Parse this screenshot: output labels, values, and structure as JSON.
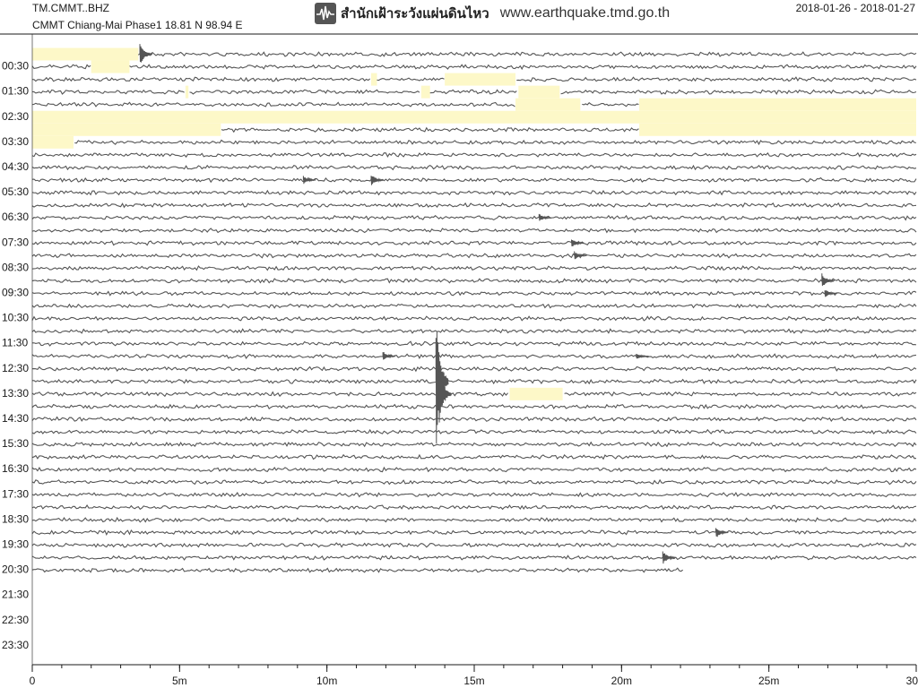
{
  "header": {
    "station_code": "TM.CMMT..BHZ",
    "station_desc": "CMMT Chiang-Mai Phase1  18.81 N 98.94 E",
    "agency_name": "สำนักเฝ้าระวังแผ่นดินไหว",
    "website": "www.earthquake.tmd.go.th",
    "date_range": "2018-01-26 - 2018-01-27",
    "logo_icon": "seismograph-icon"
  },
  "colors": {
    "trace": "#555555",
    "gap_highlight": "#fdf8c8",
    "axis": "#1a1a1a",
    "header_rule": "#1a1a1a"
  },
  "hour_labels": [
    "00:30",
    "01:30",
    "02:30",
    "03:30",
    "04:30",
    "05:30",
    "06:30",
    "07:30",
    "08:30",
    "09:30",
    "10:30",
    "11:30",
    "12:30",
    "13:30",
    "14:30",
    "15:30",
    "16:30",
    "17:30",
    "18:30",
    "19:30",
    "20:30",
    "21:30",
    "22:30",
    "23:30"
  ],
  "x_axis": {
    "labels": [
      "0",
      "5m",
      "10m",
      "15m",
      "20m",
      "25m",
      "30"
    ],
    "label_minutes": [
      0,
      5,
      10,
      15,
      20,
      25,
      30
    ],
    "minor_tick_minutes": [
      0,
      1,
      2,
      3,
      4,
      5,
      6,
      7,
      8,
      9,
      10,
      11,
      12,
      13,
      14,
      15,
      16,
      17,
      18,
      19,
      20,
      21,
      22,
      23,
      24,
      25,
      26,
      27,
      28,
      29,
      30
    ],
    "unit": "minutes",
    "range": [
      0,
      30
    ]
  },
  "traces": {
    "line_count": 42,
    "lines_per_hour": 2,
    "last_line_end_minute": 22.1,
    "gaps": [
      {
        "line": 0,
        "from_min": 0,
        "to_min": 3.6
      },
      {
        "line": 1,
        "from_min": 2.0,
        "to_min": 3.3
      },
      {
        "line": 2,
        "from_min": 11.5,
        "to_min": 11.7
      },
      {
        "line": 2,
        "from_min": 14.0,
        "to_min": 16.4
      },
      {
        "line": 3,
        "from_min": 5.2,
        "to_min": 5.3
      },
      {
        "line": 3,
        "from_min": 13.2,
        "to_min": 13.5
      },
      {
        "line": 3,
        "from_min": 16.5,
        "to_min": 17.9
      },
      {
        "line": 4,
        "from_min": 16.4,
        "to_min": 18.6
      },
      {
        "line": 4,
        "from_min": 20.6,
        "to_min": 30
      },
      {
        "line": 5,
        "from_min": 0,
        "to_min": 30
      },
      {
        "line": 6,
        "from_min": 0,
        "to_min": 6.4
      },
      {
        "line": 6,
        "from_min": 20.6,
        "to_min": 30
      },
      {
        "line": 7,
        "from_min": 0,
        "to_min": 1.4
      },
      {
        "line": 27,
        "from_min": 16.2,
        "to_min": 18.0
      }
    ],
    "events": [
      {
        "line": 0,
        "minute": 3.65,
        "amplitude": 16
      },
      {
        "line": 10,
        "minute": 11.5,
        "amplitude": 8
      },
      {
        "line": 10,
        "minute": 9.2,
        "amplitude": 5
      },
      {
        "line": 13,
        "minute": 17.2,
        "amplitude": 5
      },
      {
        "line": 15,
        "minute": 18.3,
        "amplitude": 6
      },
      {
        "line": 16,
        "minute": 18.4,
        "amplitude": 5
      },
      {
        "line": 18,
        "minute": 26.8,
        "amplitude": 9
      },
      {
        "line": 19,
        "minute": 26.9,
        "amplitude": 5
      },
      {
        "line": 24,
        "minute": 11.9,
        "amplitude": 6
      },
      {
        "line": 24,
        "minute": 20.5,
        "amplitude": 4
      },
      {
        "line": 26,
        "minute": 13.7,
        "amplitude": 80
      },
      {
        "line": 27,
        "minute": 13.8,
        "amplitude": 40
      },
      {
        "line": 38,
        "minute": 23.2,
        "amplitude": 7
      },
      {
        "line": 40,
        "minute": 21.4,
        "amplitude": 9
      }
    ]
  }
}
